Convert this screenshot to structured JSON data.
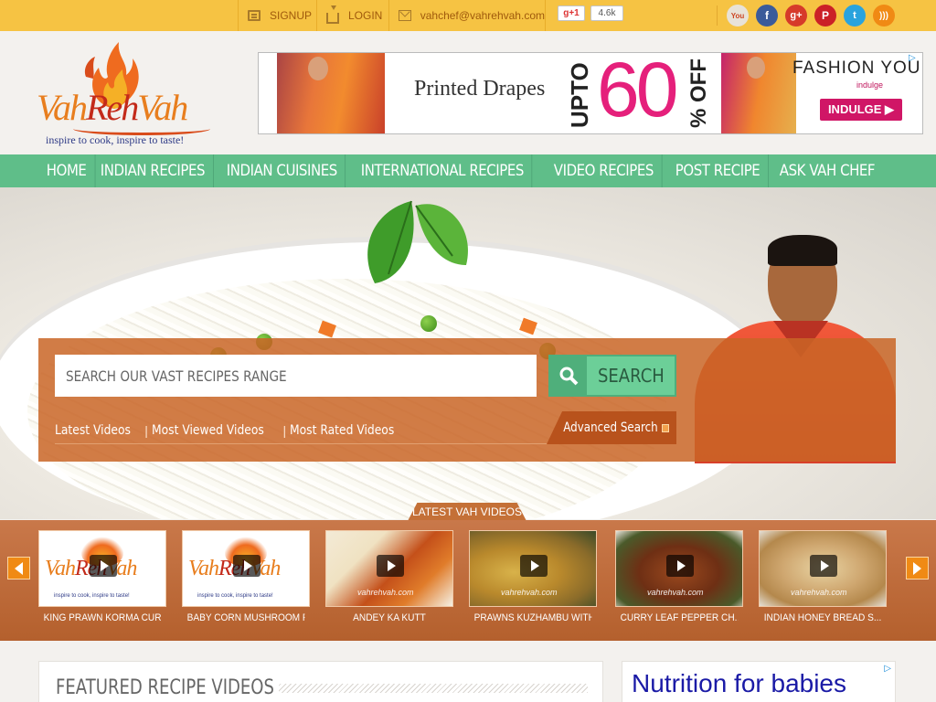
{
  "topbar": {
    "signup": "SIGNUP",
    "login": "LOGIN",
    "email": "vahchef@vahrehvah.com",
    "gplus_label": "g+1",
    "gplus_count": "4.6k",
    "social_icons": [
      "youtube-icon",
      "facebook-icon",
      "google-plus-icon",
      "pinterest-icon",
      "twitter-icon",
      "rss-icon"
    ]
  },
  "logo": {
    "part1": "Vah",
    "part2": "Reh",
    "part3": "Vah",
    "tagline": "inspire to cook, inspire to taste!"
  },
  "ad_banner": {
    "text": "Printed Drapes",
    "upto": "UPTO",
    "percent": "60",
    "off": "% OFF",
    "brand": "FASHION YOU",
    "brand_sub": "indulge",
    "cta": "INDULGE ▶"
  },
  "nav": {
    "items": [
      "HOME",
      "INDIAN RECIPES",
      "INDIAN CUISINES",
      "INTERNATIONAL RECIPES",
      "VIDEO RECIPES",
      "POST RECIPE",
      "ASK VAH CHEF"
    ]
  },
  "search": {
    "placeholder": "SEARCH OUR VAST RECIPES RANGE",
    "button": "SEARCH",
    "links": [
      "Latest Videos",
      "Most Viewed Videos",
      "Most Rated Videos"
    ],
    "advanced": "Advanced Search"
  },
  "latest_videos": {
    "title": "LATEST VAH VIDEOS",
    "items": [
      {
        "caption": "KING PRAWN KORMA CUR..."
      },
      {
        "caption": "BABY CORN MUSHROOM P..."
      },
      {
        "caption": "ANDEY KA KUTT"
      },
      {
        "caption": "PRAWNS KUZHAMBU WITH..."
      },
      {
        "caption": "CURRY LEAF PEPPER CH..."
      },
      {
        "caption": "INDIAN HONEY BREAD S..."
      }
    ],
    "watermark": "vahrehvah.com"
  },
  "featured": {
    "title": "FEATURED RECIPE VIDEOS"
  },
  "ad_side": {
    "text": "Nutrition for babies"
  },
  "colors": {
    "topbar": "#f6c343",
    "nav": "#5fbe89",
    "search_panel": "#c96526",
    "accent_orange": "#f08a14"
  }
}
